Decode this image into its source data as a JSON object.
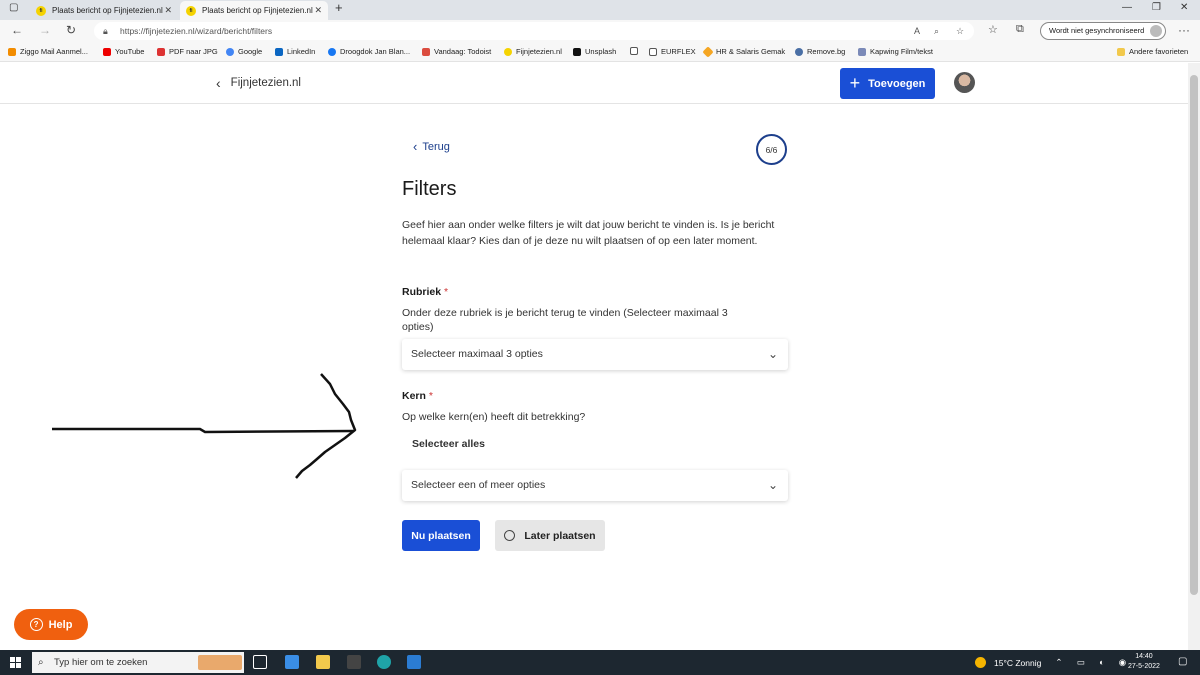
{
  "browser": {
    "tabs": [
      {
        "title": "Plaats bericht op Fijnjetezien.nl",
        "favicon": "fijnjetezien-icon"
      },
      {
        "title": "Plaats bericht op Fijnjetezien.nl",
        "favicon": "fijnjetezien-icon"
      }
    ],
    "url": "https://fijnjetezien.nl/wizard/bericht/filters",
    "sync_label": "Wordt niet gesynchroniseerd",
    "bookmarks": [
      "Ziggo Mail Aanmel...",
      "YouTube",
      "PDF naar JPG",
      "Google",
      "LinkedIn",
      "Droogdok Jan Blan...",
      "Vandaag: Todoist",
      "Fijnjetezien.nl",
      "Unsplash",
      "",
      "EURFLEX",
      "HR & Salaris Gemak",
      "Remove.bg",
      "Kapwing Film/tekst"
    ],
    "other_favorites": "Andere favorieten"
  },
  "site": {
    "brand": "Fijnjetezien.nl",
    "add_button": "Toevoegen"
  },
  "form": {
    "back": "Terug",
    "step": "6/6",
    "title": "Filters",
    "intro": "Geef hier aan onder welke filters je wilt dat jouw bericht te vinden is. Is je bericht helemaal klaar? Kies dan of je deze nu wilt plaatsen of op een later moment.",
    "rubriek": {
      "label": "Rubriek",
      "required_mark": "*",
      "help": "Onder deze rubriek is je bericht terug te vinden (Selecteer maximaal 3 opties)",
      "placeholder": "Selecteer maximaal 3 opties"
    },
    "kern": {
      "label": "Kern",
      "required_mark": "*",
      "help": "Op welke kern(en) heeft dit betrekking?",
      "select_all": "Selecteer alles",
      "placeholder": "Selecteer een of meer opties"
    },
    "publish_now": "Nu plaatsen",
    "publish_later": "Later plaatsen"
  },
  "help_button": "Help",
  "taskbar": {
    "search_placeholder": "Typ hier om te zoeken",
    "weather": "15°C  Zonnig",
    "time": "14:40",
    "date": "27-5-2022"
  },
  "colors": {
    "primary": "#1a4fd6",
    "link": "#1d3f8c",
    "help": "#f0600f"
  }
}
